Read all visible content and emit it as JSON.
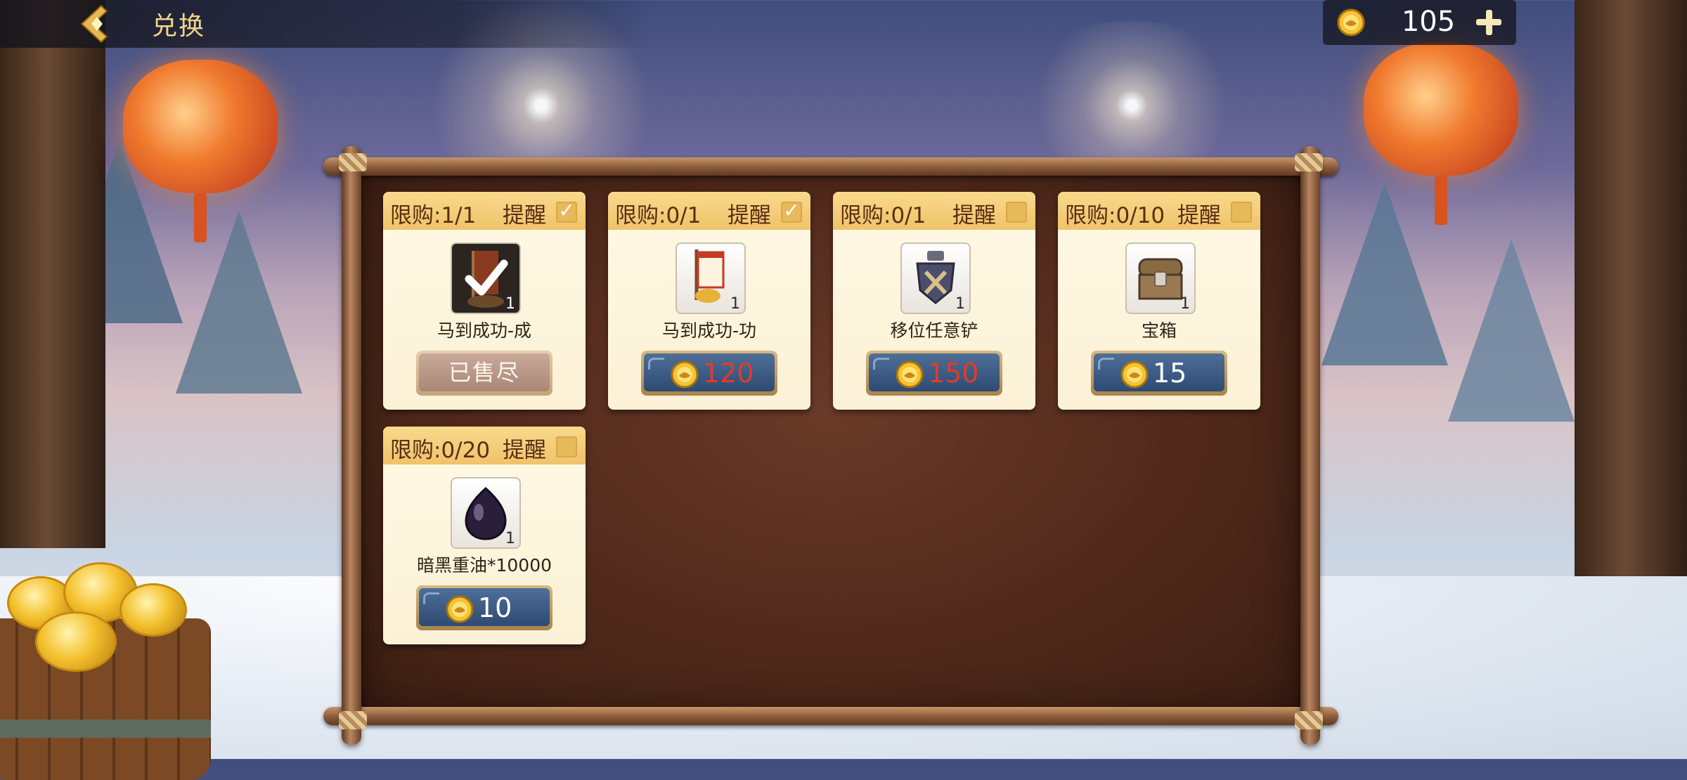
{
  "header": {
    "title": "兑换",
    "back_icon": "chevron-left-icon",
    "currency_icon": "gold-coin-icon",
    "currency_amount": "105",
    "add_icon": "plus-icon"
  },
  "colors": {
    "price_red": "#e23a2a",
    "price_white": "#ffffff",
    "title_gold": "#f3d48a"
  },
  "items": [
    {
      "limit": "限购:1/1",
      "remind": "提醒",
      "reminded": true,
      "checkmark": "✓",
      "name": "马到成功-成",
      "qty": "1",
      "icon": "cheng-banner-icon",
      "status": "已售尽",
      "price": ""
    },
    {
      "limit": "限购:0/1",
      "remind": "提醒",
      "reminded": true,
      "checkmark": "✓",
      "name": "马到成功-功",
      "qty": "1",
      "icon": "gong-banner-icon",
      "price": "120",
      "price_color": "red"
    },
    {
      "limit": "限购:0/1",
      "remind": "提醒",
      "reminded": false,
      "checkmark": "",
      "name": "移位任意铲",
      "qty": "1",
      "icon": "shovel-medal-icon",
      "price": "150",
      "price_color": "red"
    },
    {
      "limit": "限购:0/10",
      "remind": "提醒",
      "reminded": false,
      "checkmark": "",
      "name": "宝箱",
      "qty": "1",
      "icon": "treasure-chest-icon",
      "price": "15",
      "price_color": "white"
    },
    {
      "limit": "限购:0/20",
      "remind": "提醒",
      "reminded": false,
      "checkmark": "",
      "name": "暗黑重油*10000",
      "qty": "1",
      "icon": "dark-oil-drop-icon",
      "price": "10",
      "price_color": "white"
    }
  ]
}
